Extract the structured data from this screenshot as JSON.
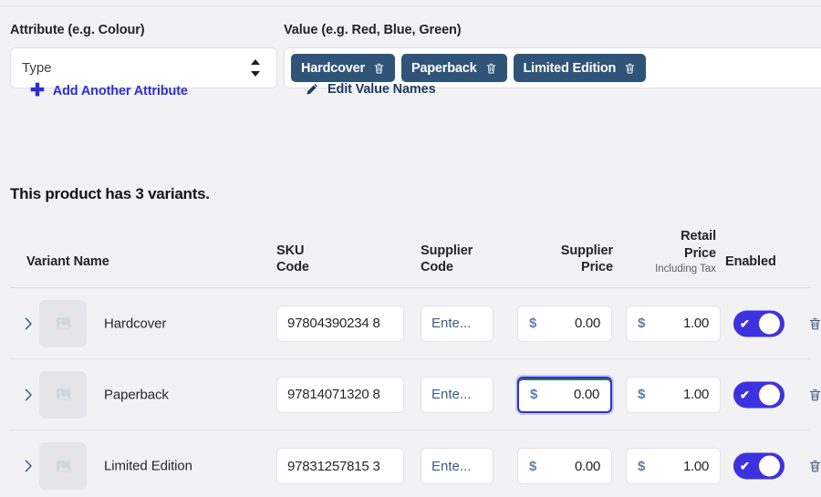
{
  "attribute_section": {
    "attribute_label": "Attribute (e.g. Colour)",
    "attribute_value": "Type",
    "value_label": "Value (e.g. Red, Blue, Green)",
    "tags": [
      {
        "label": "Hardcover",
        "delete_icon": "trash-icon"
      },
      {
        "label": "Paperback",
        "delete_icon": "trash-icon"
      },
      {
        "label": "Limited Edition",
        "delete_icon": "trash-icon"
      }
    ],
    "add_attribute_label": "Add Another Attribute",
    "add_attribute_icon": "plus-icon",
    "edit_values_label": "Edit Value Names",
    "edit_values_icon": "pencil-icon"
  },
  "variants_title": "This product has 3 variants.",
  "table": {
    "headers": {
      "variant_name": "Variant Name",
      "sku_code": "SKU\nCode",
      "sku_code_line1": "SKU",
      "sku_code_line2": "Code",
      "supplier_code_line1": "Supplier",
      "supplier_code_line2": "Code",
      "supplier_price_line1": "Supplier",
      "supplier_price_line2": "Price",
      "retail_price_line1": "Retail",
      "retail_price_line2": "Price",
      "retail_price_sub": "Including Tax",
      "enabled": "Enabled"
    },
    "rows": [
      {
        "expand_icon": "chevron-right-icon",
        "thumbnail_icon": "image-placeholder-icon",
        "name": "Hardcover",
        "sku": "97804390234 8",
        "supplier_code_placeholder": "Ente...",
        "supplier_currency": "$",
        "supplier_price": "0.00",
        "retail_currency": "$",
        "retail_price": "1.00",
        "enabled": true,
        "enabled_check": "✔",
        "delete_icon": "trash-icon",
        "supplier_price_focused": false
      },
      {
        "expand_icon": "chevron-right-icon",
        "thumbnail_icon": "image-placeholder-icon",
        "name": "Paperback",
        "sku": "97814071320 8",
        "supplier_code_placeholder": "Ente...",
        "supplier_currency": "$",
        "supplier_price": "0.00",
        "retail_currency": "$",
        "retail_price": "1.00",
        "enabled": true,
        "enabled_check": "✔",
        "delete_icon": "trash-icon",
        "supplier_price_focused": true
      },
      {
        "expand_icon": "chevron-right-icon",
        "thumbnail_icon": "image-placeholder-icon",
        "name": "Limited Edition",
        "sku": "97831257815 3",
        "supplier_code_placeholder": "Ente...",
        "supplier_currency": "$",
        "supplier_price": "0.00",
        "retail_currency": "$",
        "retail_price": "1.00",
        "enabled": true,
        "enabled_check": "✔",
        "delete_icon": "trash-icon",
        "supplier_price_focused": false
      }
    ]
  },
  "colors": {
    "page_bg": "#f2f2f4",
    "tag_bg": "#2f5478",
    "link_blue": "#2e2ed6",
    "link_navy": "#1f3a63",
    "toggle_on": "#3d31e0",
    "focus_ring": "#2e2ed6",
    "text_dark": "#1b1c21",
    "border": "#e2e2e8"
  }
}
